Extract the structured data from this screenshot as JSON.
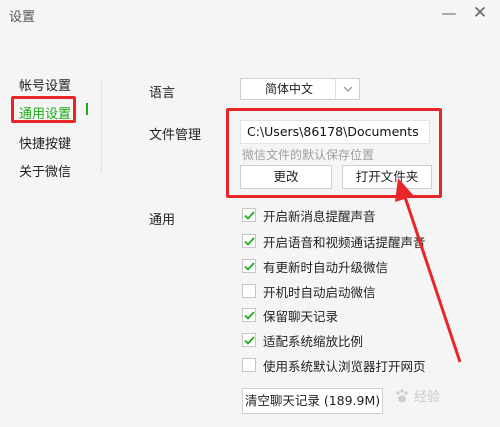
{
  "window": {
    "title": "设置",
    "minimize_glyph": "—",
    "close_glyph": "✕"
  },
  "sidebar": {
    "items": [
      {
        "label": "帐号设置"
      },
      {
        "label": "通用设置"
      },
      {
        "label": "快捷按键"
      },
      {
        "label": "关于微信"
      }
    ],
    "active_index": 1
  },
  "language": {
    "label": "语言",
    "value": "简体中文"
  },
  "file_management": {
    "label": "文件管理",
    "path": "C:\\Users\\86178\\Documents",
    "hint": "微信文件的默认保存位置",
    "change_button": "更改",
    "open_folder_button": "打开文件夹"
  },
  "general": {
    "label": "通用",
    "options": [
      {
        "label": "开启新消息提醒声音",
        "checked": true
      },
      {
        "label": "开启语音和视频通话提醒声音",
        "checked": true
      },
      {
        "label": "有更新时自动升级微信",
        "checked": true
      },
      {
        "label": "开机时自动启动微信",
        "checked": false
      },
      {
        "label": "保留聊天记录",
        "checked": true
      },
      {
        "label": "适配系统缩放比例",
        "checked": true
      },
      {
        "label": "使用系统默认浏览器打开网页",
        "checked": false
      }
    ],
    "clear_button": "清空聊天记录 (189.9M)"
  },
  "watermark": {
    "text": "经验"
  },
  "colors": {
    "accent": "#1aad19",
    "highlight": "#e8262a",
    "background": "#f5f5f5"
  }
}
